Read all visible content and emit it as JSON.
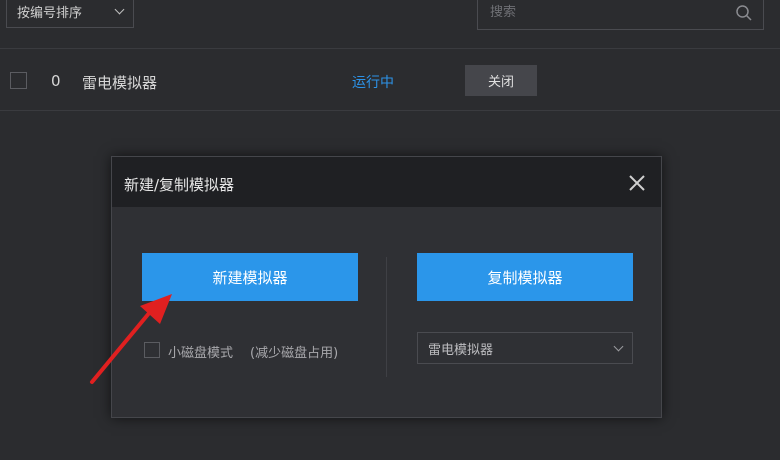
{
  "toolbar": {
    "sort_label": "按编号排序",
    "search_placeholder": "搜索"
  },
  "list": {
    "rows": [
      {
        "index": "0",
        "name": "雷电模拟器",
        "status": "运行中",
        "action": "关闭"
      }
    ]
  },
  "dialog": {
    "title": "新建/复制模拟器",
    "new_button": "新建模拟器",
    "copy_button": "复制模拟器",
    "small_disk_label": "小磁盘模式",
    "small_disk_hint": "(减少磁盘占用)",
    "copy_source_selected": "雷电模拟器"
  },
  "colors": {
    "background": "#2b2c2f",
    "accent_blue": "#2b96ea",
    "status_blue": "#2c93e8",
    "annotation_red": "#e02020"
  }
}
